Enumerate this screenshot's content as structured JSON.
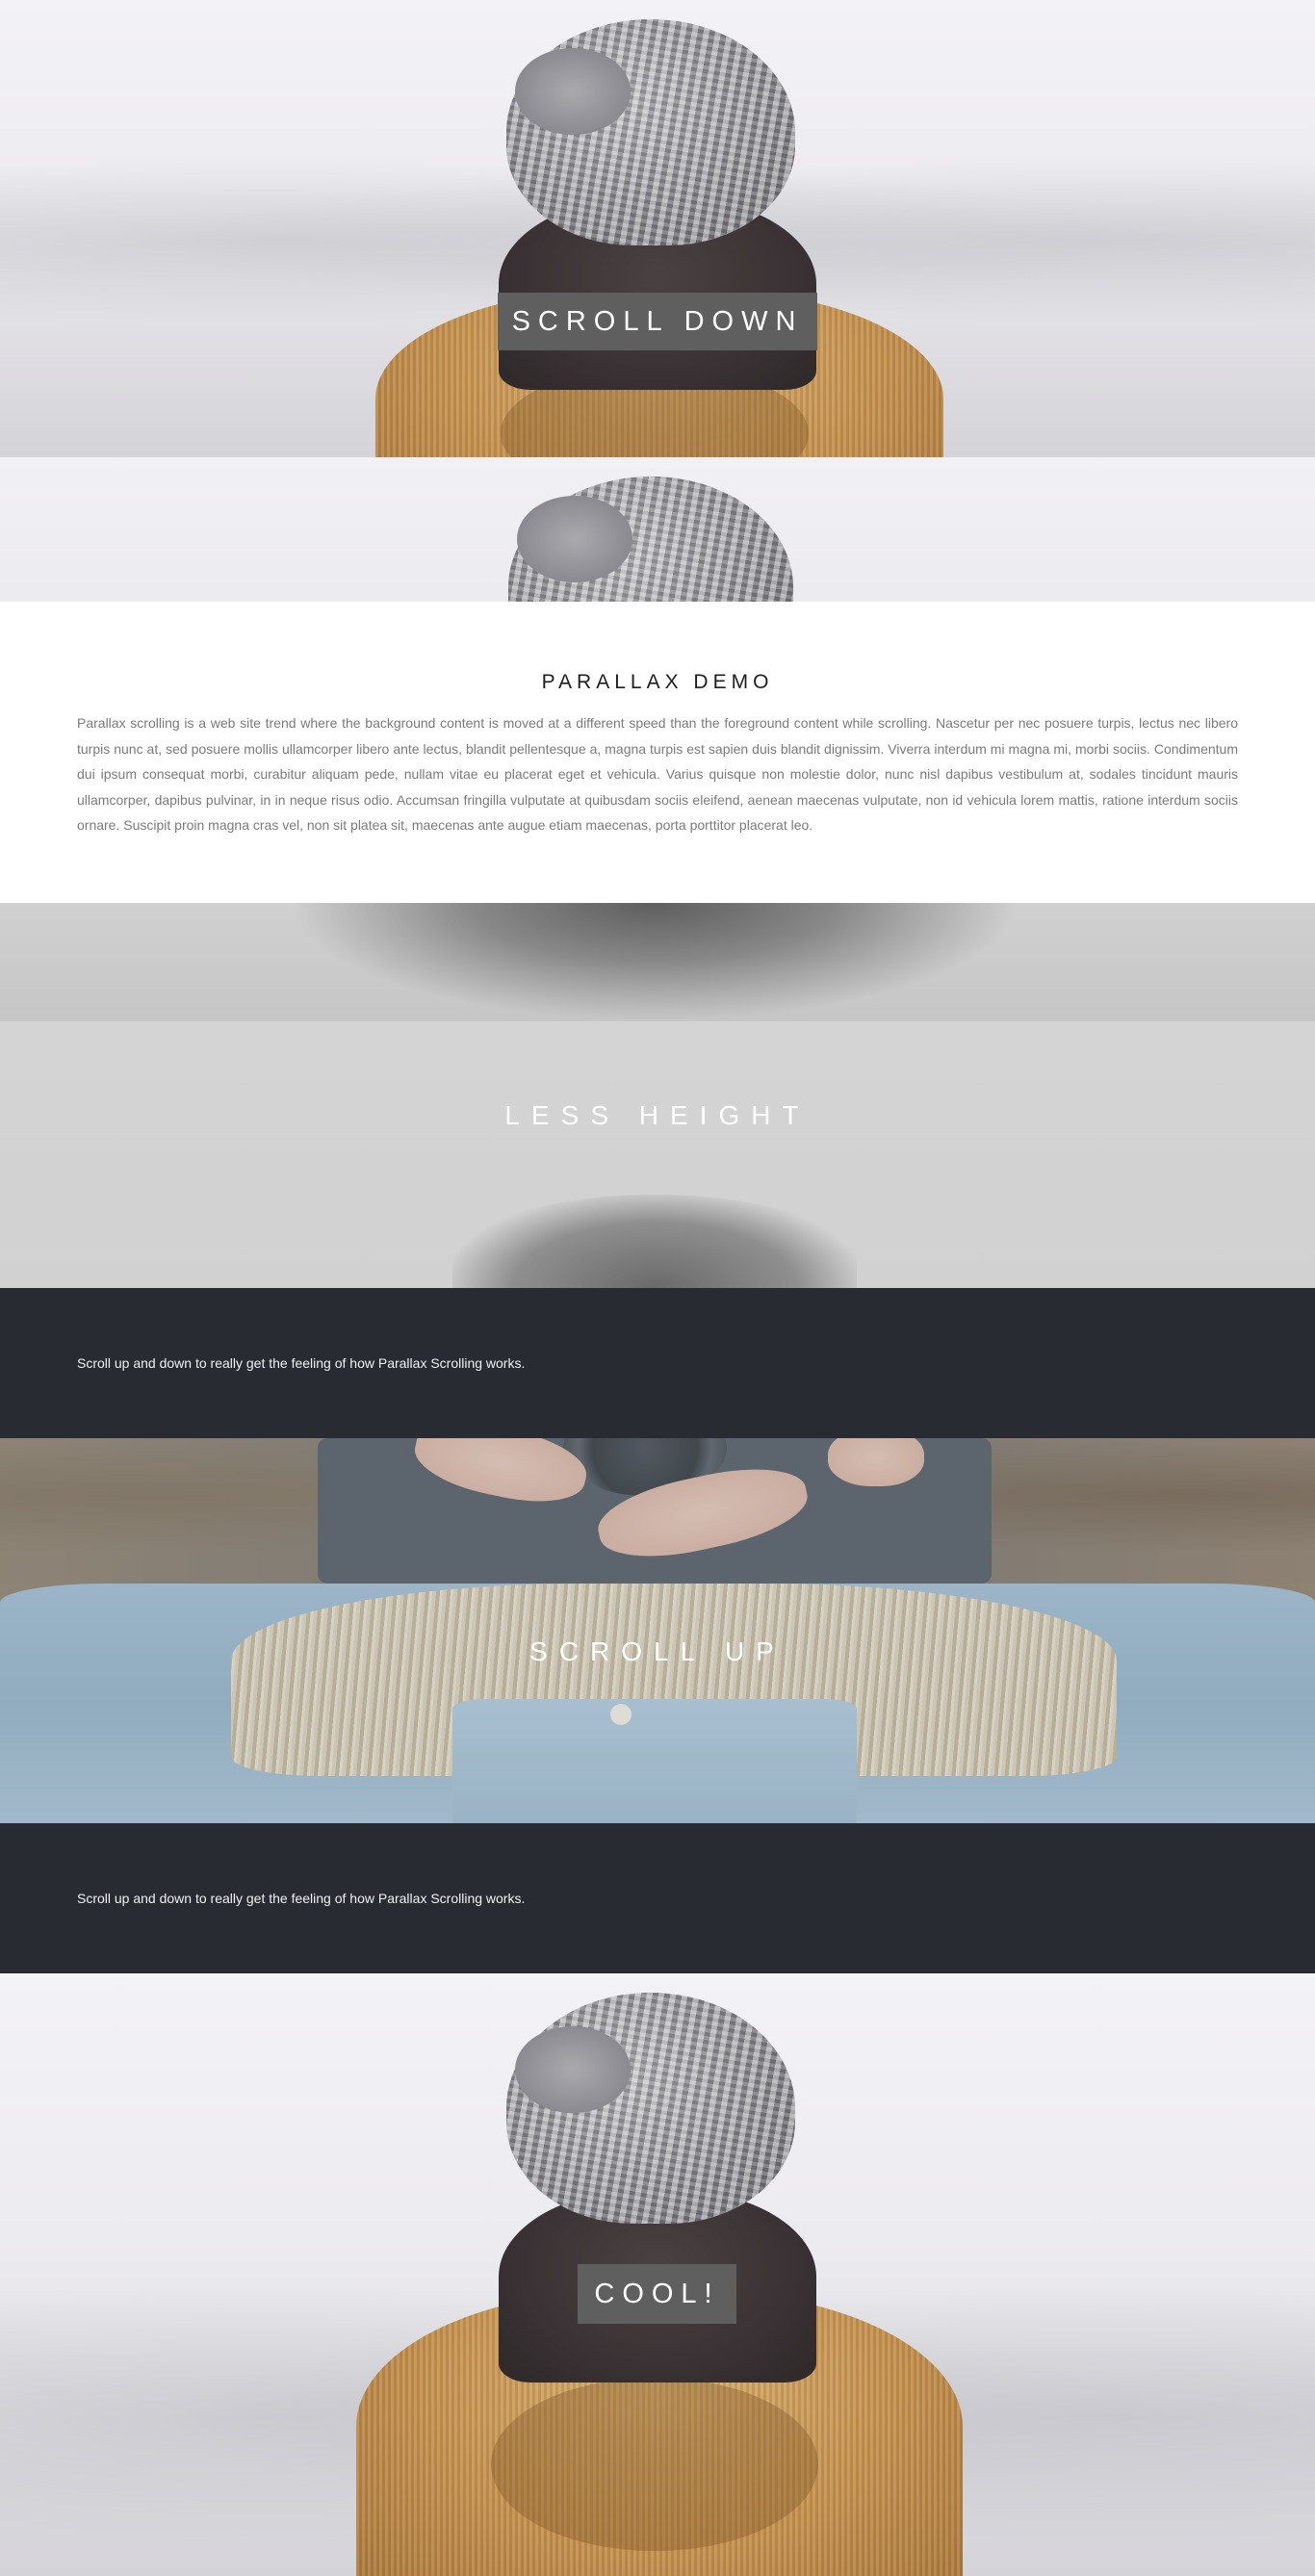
{
  "hero": {
    "label": "SCROLL DOWN"
  },
  "intro": {
    "title": "PARALLAX DEMO",
    "body": "Parallax scrolling is a web site trend where the background content is moved at a different speed than the foreground content while scrolling. Nascetur per nec posuere turpis, lectus nec libero turpis nunc at, sed posuere mollis ullamcorper libero ante lectus, blandit pellentesque a, magna turpis est sapien duis blandit dignissim. Viverra interdum mi magna mi, morbi sociis. Condimentum dui ipsum consequat morbi, curabitur aliquam pede, nullam vitae eu placerat eget et vehicula. Varius quisque non molestie dolor, nunc nisl dapibus vestibulum at, sodales tincidunt mauris ullamcorper, dapibus pulvinar, in in neque risus odio. Accumsan fringilla vulputate at quibusdam sociis eleifend, aenean maecenas vulputate, non id vehicula lorem mattis, ratione interdum sociis ornare. Suscipit proin magna cras vel, non sit platea sit, maecenas ante augue etiam maecenas, porta porttitor placerat leo."
  },
  "less_height": {
    "label": "LESS HEIGHT"
  },
  "band_1": {
    "text": "Scroll up and down to really get the feeling of how Parallax Scrolling works."
  },
  "scroll_up": {
    "label": "SCROLL UP"
  },
  "band_2": {
    "text": "Scroll up and down to really get the feeling of how Parallax Scrolling works."
  },
  "footer_hero": {
    "label": "COOL!"
  },
  "colors": {
    "dark_band": "#282b32",
    "label_box": "#5f5f60",
    "body_text": "#7a7a7a"
  }
}
